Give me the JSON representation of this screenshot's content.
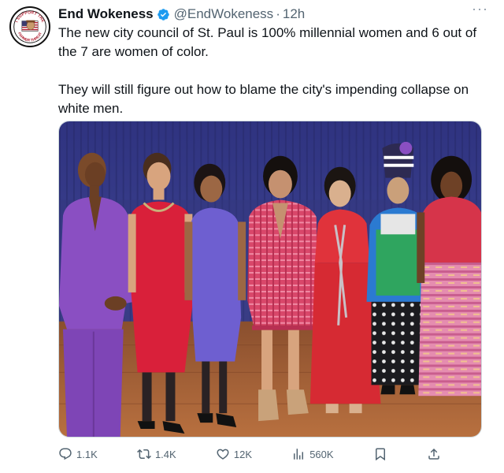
{
  "tweet": {
    "author": {
      "display_name": "End Wokeness",
      "handle": "@EndWokeness",
      "verified": true,
      "verified_color": "#1d9bf0",
      "avatar_icon": "support-badge-avatar",
      "avatar_text_top": "I SUPPORT THE",
      "avatar_text_bottom": "FARMER THREAT"
    },
    "separator": "·",
    "time": "12h",
    "more_icon": "more-horizontal-icon",
    "more_label": "···",
    "text": [
      "The new city council of St. Paul is 100% millennial women and 6 out of the 7 are women of color.",
      "They will still figure out how to blame the city's impending collapse on white men."
    ],
    "media": {
      "kind": "photo",
      "colors": {
        "backdrop": "#3b3f8c",
        "floor": "#a8623a"
      }
    },
    "actions": {
      "reply": {
        "icon": "reply-icon",
        "count": "1.1K"
      },
      "retweet": {
        "icon": "retweet-icon",
        "count": "1.4K"
      },
      "like": {
        "icon": "heart-icon",
        "count": "12K"
      },
      "views": {
        "icon": "analytics-icon",
        "count": "560K"
      },
      "bookmark": {
        "icon": "bookmark-icon"
      },
      "share": {
        "icon": "share-icon"
      }
    }
  },
  "colors": {
    "text": "#0f1419",
    "secondary": "#536471",
    "border": "#cfd9de"
  }
}
